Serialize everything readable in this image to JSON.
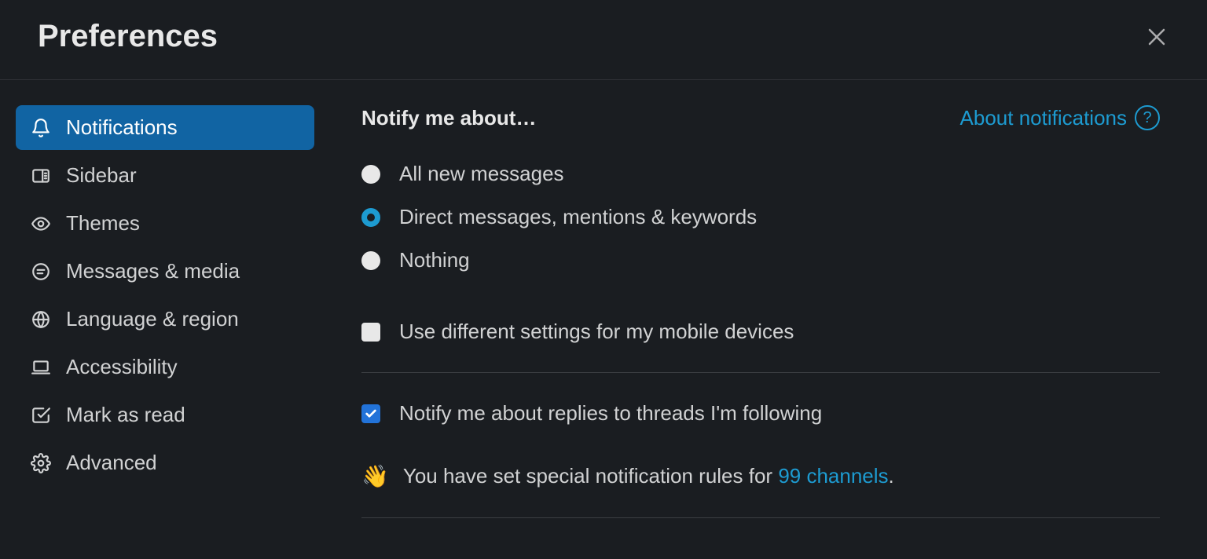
{
  "header": {
    "title": "Preferences"
  },
  "sidebar": {
    "items": [
      {
        "label": "Notifications",
        "icon": "bell",
        "active": true
      },
      {
        "label": "Sidebar",
        "icon": "panel",
        "active": false
      },
      {
        "label": "Themes",
        "icon": "eye",
        "active": false
      },
      {
        "label": "Messages & media",
        "icon": "chat",
        "active": false
      },
      {
        "label": "Language & region",
        "icon": "globe",
        "active": false
      },
      {
        "label": "Accessibility",
        "icon": "laptop",
        "active": false
      },
      {
        "label": "Mark as read",
        "icon": "check-square",
        "active": false
      },
      {
        "label": "Advanced",
        "icon": "gear",
        "active": false
      }
    ]
  },
  "content": {
    "section_title": "Notify me about…",
    "help_link": "About notifications",
    "radios": [
      {
        "label": "All new messages",
        "selected": false
      },
      {
        "label": "Direct messages, mentions & keywords",
        "selected": true
      },
      {
        "label": "Nothing",
        "selected": false
      }
    ],
    "mobile_checkbox": {
      "label": "Use different settings for my mobile devices",
      "checked": false
    },
    "threads_checkbox": {
      "label": "Notify me about replies to threads I'm following",
      "checked": true
    },
    "special": {
      "prefix": "You have set special notification rules for ",
      "link": "99 channels",
      "suffix": "."
    }
  }
}
